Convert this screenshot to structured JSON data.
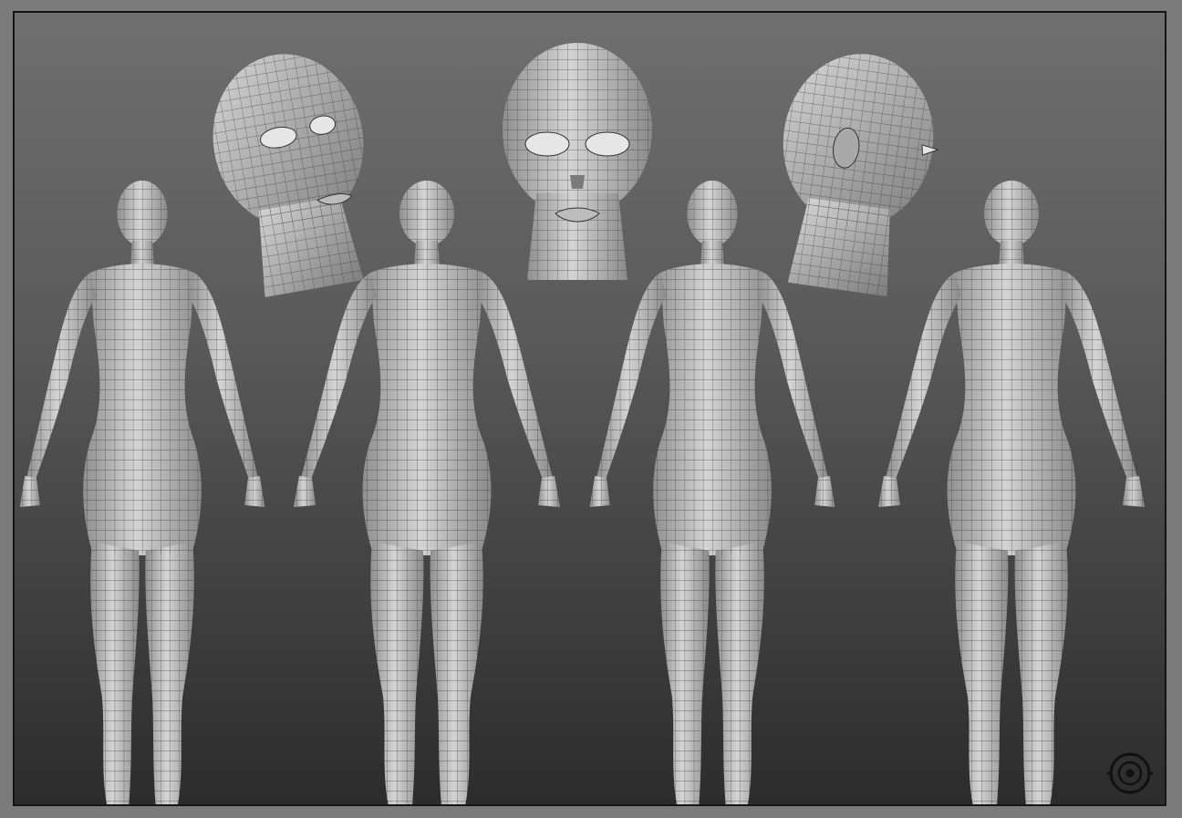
{
  "sheet": {
    "background_top": "#6f6f6f",
    "background_bottom": "#2c2c2c",
    "border_color": "#151515",
    "model_color": "#c9c9c9",
    "wire_color": "#2a2a2a"
  },
  "heads": [
    {
      "view": "three-quarter"
    },
    {
      "view": "front"
    },
    {
      "view": "side"
    }
  ],
  "bodies": [
    {
      "view": "three-quarter-front"
    },
    {
      "view": "front"
    },
    {
      "view": "three-quarter-back"
    },
    {
      "view": "back"
    }
  ],
  "logo": {
    "icon": "circular-logo-icon"
  }
}
